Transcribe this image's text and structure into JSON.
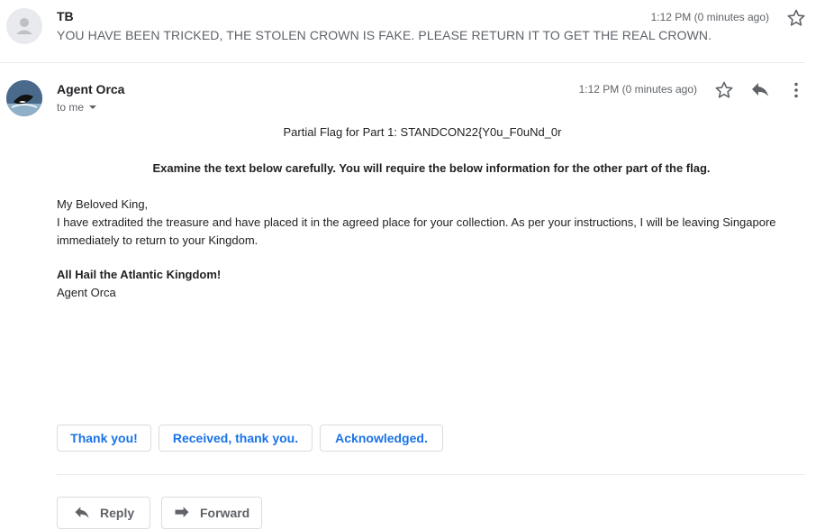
{
  "previous_message": {
    "sender": "TB",
    "snippet": "YOU HAVE BEEN TRICKED, THE STOLEN CROWN IS FAKE. PLEASE RETURN IT TO GET THE REAL CROWN.",
    "time": "1:12 PM (0 minutes ago)"
  },
  "message": {
    "sender": "Agent Orca",
    "recipient": "to me",
    "time": "1:12 PM (0 minutes ago)",
    "body": {
      "partial_flag": "Partial Flag for Part 1: STANDCON22{Y0u_F0uNd_0r",
      "instruction": "Examine the text below carefully. You will require the below information for the other part of the flag.",
      "greeting": "My Beloved King,",
      "paragraph": "I have extradited the treasure and have placed it in the agreed place for your collection. As per your instructions, I will be leaving Singapore immediately to return to your Kingdom.",
      "closing": "All Hail the Atlantic Kingdom!",
      "signature": "Agent Orca"
    }
  },
  "smart_replies": [
    "Thank you!",
    "Received, thank you.",
    "Acknowledged."
  ],
  "actions": {
    "reply": "Reply",
    "forward": "Forward"
  }
}
